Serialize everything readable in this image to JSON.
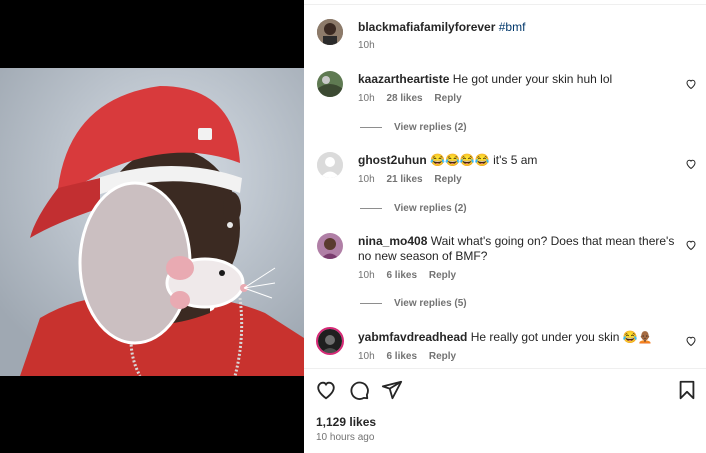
{
  "post": {
    "author": "blackmafiafamilyforever",
    "caption": "#bmf",
    "time": "10h"
  },
  "comments": [
    {
      "user": "kaazartheartiste",
      "text": "He got under your skin huh lol",
      "time": "10h",
      "likes": "28 likes",
      "reply": "Reply",
      "view_replies": "View replies (2)"
    },
    {
      "user": "ghost2uhun",
      "text": "😂😂😂😂 it's 5 am",
      "time": "10h",
      "likes": "21 likes",
      "reply": "Reply",
      "view_replies": "View replies (2)"
    },
    {
      "user": "nina_mo408",
      "text_line1": "Wait what's going on? Does that mean there's",
      "text_line2": "no new season of BMF?",
      "time": "10h",
      "likes": "6 likes",
      "reply": "Reply",
      "view_replies": "View replies (5)"
    },
    {
      "user": "yabmfavdreadhead",
      "text": "He really got under you skin 😂🧑🏾‍🦲",
      "time": "10h",
      "likes": "6 likes",
      "reply": "Reply"
    }
  ],
  "footer": {
    "likes": "1,129 likes",
    "ago": "10 hours ago"
  },
  "icons": {
    "like": "heart-icon",
    "comment": "comment-icon",
    "share": "share-icon",
    "save": "bookmark-icon"
  }
}
